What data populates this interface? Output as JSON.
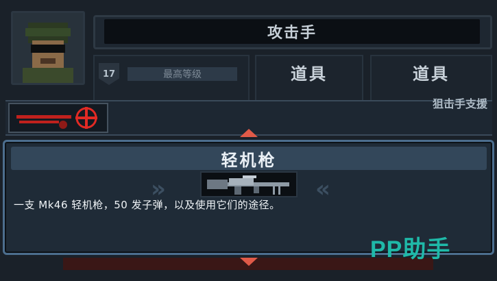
{
  "header": {
    "title": "攻击手"
  },
  "stats": {
    "level": "17",
    "max_level_label": "最高等级"
  },
  "items": {
    "item1_label": "道具",
    "item2_label": "道具"
  },
  "weapon_strip": {
    "support_label": "狙击手支援"
  },
  "dialog": {
    "title": "轻机枪",
    "description": "一支 Mk46 轻机枪，50 发子弹，以及使用它们的途径。"
  },
  "watermark": {
    "text": "PP助手"
  },
  "icons": {
    "avatar": "soldier-portrait-icon",
    "sniper": "sniper-rifle-icon",
    "gun": "machine-gun-icon"
  },
  "colors": {
    "accent_red": "#e05a48",
    "dialog_border": "#4c6e8e",
    "watermark": "#1fb9a8"
  }
}
